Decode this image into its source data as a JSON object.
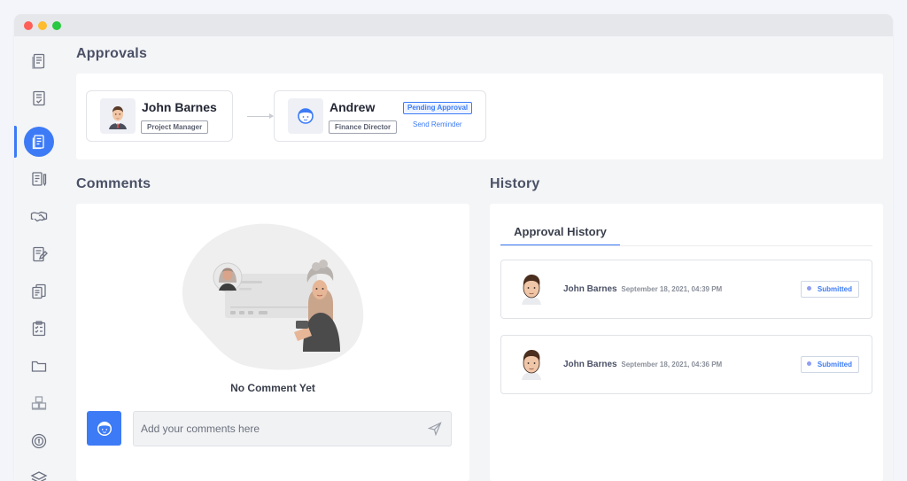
{
  "sidebar": {
    "items": [
      {
        "icon": "document-icon",
        "active": false
      },
      {
        "icon": "checklist-icon",
        "active": false
      },
      {
        "icon": "approval-document-icon",
        "active": true
      },
      {
        "icon": "document-pen-icon",
        "active": false
      },
      {
        "icon": "handshake-icon",
        "active": false
      },
      {
        "icon": "edit-document-icon",
        "active": false
      },
      {
        "icon": "files-icon",
        "active": false
      },
      {
        "icon": "clipboard-check-icon",
        "active": false
      },
      {
        "icon": "folder-icon",
        "active": false
      },
      {
        "icon": "boxes-icon",
        "active": false
      },
      {
        "icon": "target-coin-icon",
        "active": false
      },
      {
        "icon": "layers-icon",
        "active": false
      }
    ]
  },
  "approvals": {
    "title": "Approvals",
    "approvers": [
      {
        "name": "John Barnes",
        "role": "Project Manager"
      },
      {
        "name": "Andrew",
        "role": "Finance Director",
        "status": "Pending Approval",
        "action": "Send Reminder"
      }
    ]
  },
  "comments": {
    "title": "Comments",
    "empty_text": "No Comment Yet",
    "input_placeholder": "Add your comments here"
  },
  "history": {
    "title": "History",
    "tab_label": "Approval History",
    "entries": [
      {
        "name": "John Barnes",
        "date": "September 18, 2021, 04:39 PM",
        "status": "Submitted"
      },
      {
        "name": "John Barnes",
        "date": "September 18, 2021, 04:36 PM",
        "status": "Submitted"
      }
    ]
  },
  "colors": {
    "accent": "#3d7bf6",
    "background": "#f4f5f7",
    "card": "#ffffff"
  }
}
